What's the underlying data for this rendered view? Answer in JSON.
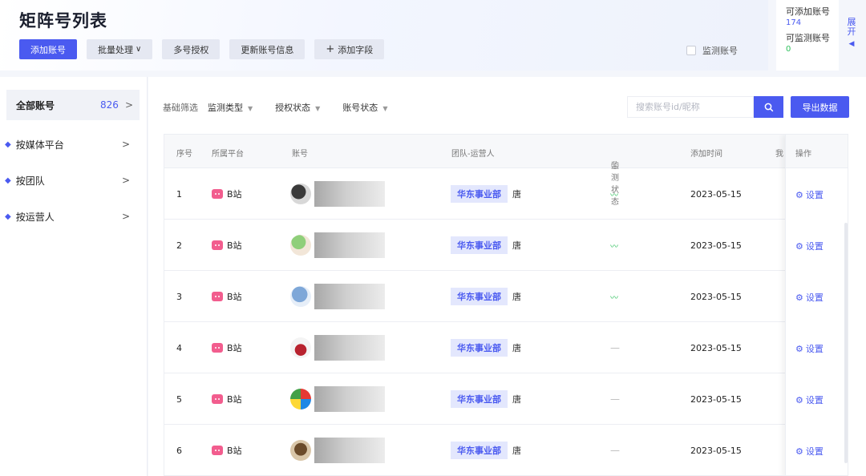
{
  "header": {
    "title": "矩阵号列表",
    "buttons": {
      "add": "添加账号",
      "batch": "批量处理",
      "multi_auth": "多号授权",
      "update_info": "更新账号信息",
      "add_field": "添加字段"
    },
    "monitor_label": "监测账号"
  },
  "quota": {
    "addable_label": "可添加账号",
    "addable_value": "174",
    "monitorable_label": "可监测账号",
    "monitorable_value": "0",
    "expand_label_1": "展",
    "expand_label_2": "开"
  },
  "sidebar": {
    "all_label": "全部账号",
    "all_count": "826",
    "items": [
      {
        "label": "按媒体平台"
      },
      {
        "label": "按团队"
      },
      {
        "label": "按运营人"
      }
    ]
  },
  "filters": {
    "base_label": "基础筛选",
    "monitor_type": "监测类型",
    "auth_status": "授权状态",
    "account_status": "账号状态",
    "search_placeholder": "搜索账号id/昵称",
    "export_label": "导出数据"
  },
  "table": {
    "columns": {
      "index": "序号",
      "platform": "所属平台",
      "account": "账号",
      "team": "团队-运营人",
      "monitor": "监测状态",
      "added": "添加时间",
      "extra": "我",
      "action": "操作"
    },
    "rows": [
      {
        "index": "1",
        "platform": "B站",
        "team": "华东事业部",
        "operator": "唐",
        "monitor": "〰",
        "added": "2023-05-15",
        "action": "设置"
      },
      {
        "index": "2",
        "platform": "B站",
        "team": "华东事业部",
        "operator": "唐",
        "monitor": "〰",
        "added": "2023-05-15",
        "action": "设置"
      },
      {
        "index": "3",
        "platform": "B站",
        "team": "华东事业部",
        "operator": "唐",
        "monitor": "〰",
        "added": "2023-05-15",
        "action": "设置"
      },
      {
        "index": "4",
        "platform": "B站",
        "team": "华东事业部",
        "operator": "唐",
        "monitor": "—",
        "added": "2023-05-15",
        "action": "设置"
      },
      {
        "index": "5",
        "platform": "B站",
        "team": "华东事业部",
        "operator": "唐",
        "monitor": "—",
        "added": "2023-05-15",
        "action": "设置"
      },
      {
        "index": "6",
        "platform": "B站",
        "team": "华东事业部",
        "operator": "唐",
        "monitor": "—",
        "added": "2023-05-15",
        "action": "设置"
      }
    ]
  },
  "colors": {
    "primary": "#4a5af0",
    "bilibili_pink": "#f25d8e",
    "monitor_green": "#2ec05c"
  }
}
